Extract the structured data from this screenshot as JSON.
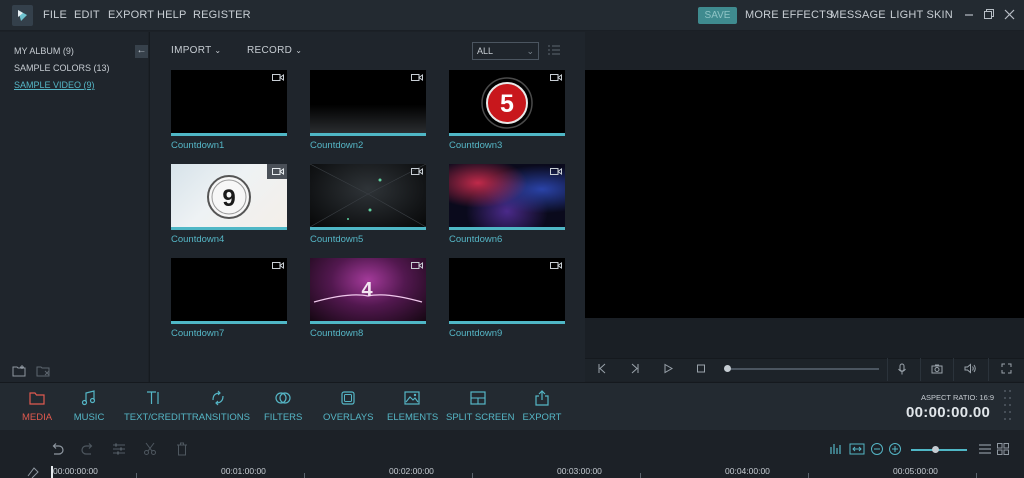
{
  "menu": {
    "file": "FILE",
    "edit": "EDIT",
    "export": "EXPORT",
    "help": "HELP",
    "register": "REGISTER"
  },
  "topbar": {
    "save": "SAVE",
    "more_effects": "MORE EFFECTS",
    "message": "MESSAGE",
    "light_skin": "LIGHT SKIN"
  },
  "albums": [
    {
      "label": "MY ALBUM (9)"
    },
    {
      "label": "SAMPLE COLORS (13)"
    },
    {
      "label": "SAMPLE VIDEO (9)"
    }
  ],
  "media_toolbar": {
    "import": "IMPORT",
    "record": "RECORD",
    "filter_selected": "ALL"
  },
  "media": [
    {
      "label": "Countdown1"
    },
    {
      "label": "Countdown2"
    },
    {
      "label": "Countdown3",
      "badge": "5"
    },
    {
      "label": "Countdown4",
      "badge": "9"
    },
    {
      "label": "Countdown5"
    },
    {
      "label": "Countdown6"
    },
    {
      "label": "Countdown7"
    },
    {
      "label": "Countdown8",
      "badge": "4"
    },
    {
      "label": "Countdown9"
    }
  ],
  "tools": [
    {
      "label": "MEDIA",
      "icon": "folder-icon"
    },
    {
      "label": "MUSIC",
      "icon": "music-note-icon"
    },
    {
      "label": "TEXT/CREDIT",
      "icon": "text-icon"
    },
    {
      "label": "TRANSITIONS",
      "icon": "transition-icon"
    },
    {
      "label": "FILTERS",
      "icon": "filter-icon"
    },
    {
      "label": "OVERLAYS",
      "icon": "overlay-icon"
    },
    {
      "label": "ELEMENTS",
      "icon": "image-icon"
    },
    {
      "label": "SPLIT SCREEN",
      "icon": "split-screen-icon"
    },
    {
      "label": "EXPORT",
      "icon": "export-icon"
    }
  ],
  "aspect_ratio": "ASPECT RATIO: 16:9",
  "timecode": "00:00:00.00",
  "ruler": [
    "00:00:00:00",
    "00:01:00:00",
    "00:02:00:00",
    "00:03:00:00",
    "00:04:00:00",
    "00:05:00:00"
  ],
  "colors": {
    "accent": "#55b6c6",
    "active_tab": "#e05a4f",
    "save_button": "#3f8b8f"
  }
}
